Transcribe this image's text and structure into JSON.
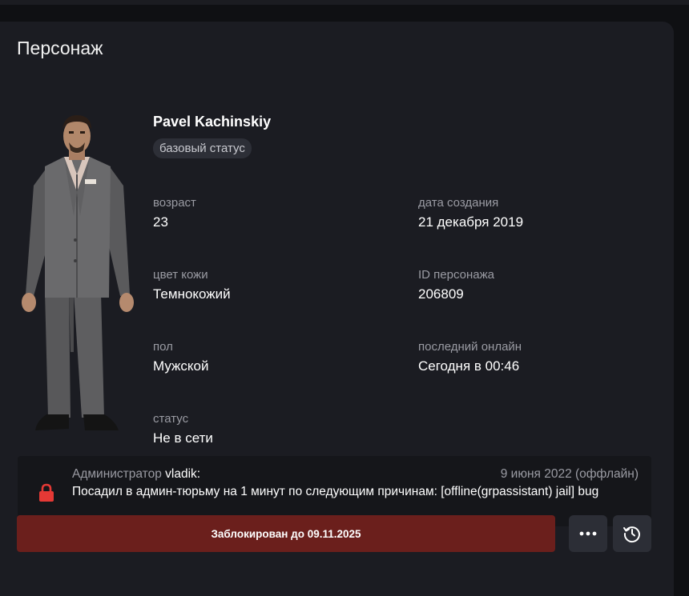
{
  "card": {
    "title": "Персонаж"
  },
  "character": {
    "name": "Pavel Kachinskiy",
    "status_chip": "базовый статус",
    "fields": {
      "age": {
        "label": "возраст",
        "value": "23"
      },
      "created": {
        "label": "дата создания",
        "value": "21 декабря 2019"
      },
      "skin": {
        "label": "цвет кожи",
        "value": "Темнокожий"
      },
      "id": {
        "label": "ID персонажа",
        "value": "206809"
      },
      "gender": {
        "label": "пол",
        "value": "Мужской"
      },
      "last_online": {
        "label": "последний онлайн",
        "value": "Сегодня в 00:46"
      },
      "status": {
        "label": "статус",
        "value": "Не в сети"
      }
    }
  },
  "punishment": {
    "admin_prefix": "Администратор",
    "admin_name": "vladik:",
    "date": "9 июня 2022 (оффлайн)",
    "text": "Посадил в админ-тюрьму на 1 минут по следующим причинам: [offline(grpassistant) jail] bug",
    "icon": "lock-icon",
    "icon_color": "#e53935"
  },
  "actions": {
    "ban_label": "Заблокирован до 09.11.2025",
    "ban_color": "#6b1f1c",
    "more_icon": "more-dots-icon",
    "history_icon": "history-clock-icon"
  }
}
